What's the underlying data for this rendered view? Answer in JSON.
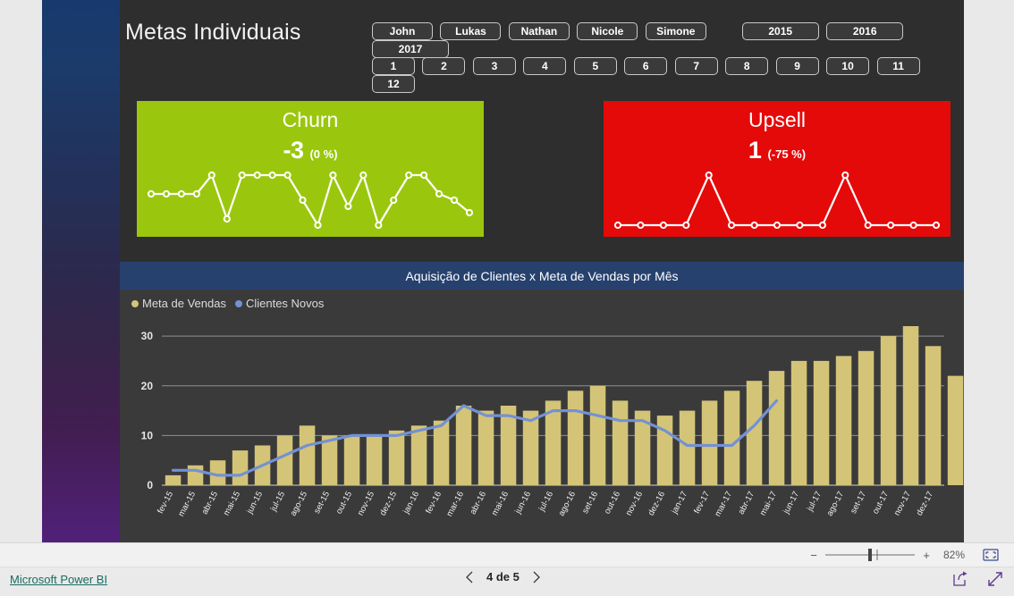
{
  "report": {
    "title": "Metas Individuais"
  },
  "slicers": {
    "people": [
      "John",
      "Lukas",
      "Nathan",
      "Nicole",
      "Simone"
    ],
    "years": [
      "2015",
      "2016",
      "2017"
    ],
    "months": [
      "1",
      "2",
      "3",
      "4",
      "5",
      "6",
      "7",
      "8",
      "9",
      "10",
      "11",
      "12"
    ]
  },
  "kpis": [
    {
      "name": "churn",
      "title": "Churn",
      "value": "-3",
      "delta": "(0 %)",
      "color": "#9ac70d",
      "sparkline": [
        5,
        5,
        5,
        5,
        8,
        1,
        8,
        8,
        8,
        8,
        4,
        0,
        8,
        3,
        8,
        0,
        4,
        8,
        8,
        5,
        4,
        2
      ]
    },
    {
      "name": "upsell",
      "title": "Upsell",
      "value": "1",
      "delta": "(-75 %)",
      "color": "#e40a0a",
      "sparkline": [
        0,
        0,
        0,
        0,
        4,
        0,
        0,
        0,
        0,
        0,
        4,
        0,
        0,
        0,
        0
      ]
    }
  ],
  "chart_data": {
    "type": "bar",
    "title": "Aquisição de Clientes x Meta de Vendas por Mês",
    "xlabel": "",
    "ylabel": "",
    "ylim": [
      0,
      32
    ],
    "yticks": [
      0,
      10,
      20,
      30
    ],
    "grid": true,
    "legend_position": "top-left",
    "legend": [
      "Meta de Vendas",
      "Clientes Novos"
    ],
    "colors": {
      "meta_de_vendas": "#d4c477",
      "clientes_novos": "#7391d4",
      "panel_header": "#27416e",
      "panel_background": "#3a3a3a",
      "canvas_background": "#2e2e2e"
    },
    "categories": [
      "fev-15",
      "mar-15",
      "abr-15",
      "mai-15",
      "jun-15",
      "jul-15",
      "ago-15",
      "set-15",
      "out-15",
      "nov-15",
      "dez-15",
      "jan-16",
      "fev-16",
      "mar-16",
      "abr-16",
      "mai-16",
      "jun-16",
      "jul-16",
      "ago-16",
      "set-16",
      "out-16",
      "nov-16",
      "dez-16",
      "jan-17",
      "fev-17",
      "mar-17",
      "abr-17",
      "mai-17",
      "jun-17",
      "jul-17",
      "ago-17",
      "set-17",
      "out-17",
      "nov-17",
      "dez-17"
    ],
    "series": [
      {
        "name": "Meta de Vendas",
        "type": "bar",
        "color": "#d4c477",
        "values": [
          2,
          4,
          5,
          7,
          8,
          10,
          12,
          10,
          10,
          10,
          11,
          12,
          13,
          16,
          15,
          16,
          15,
          17,
          19,
          20,
          17,
          15,
          14,
          15,
          17,
          19,
          21,
          23,
          25,
          25,
          26,
          27,
          30,
          32,
          28,
          22
        ]
      },
      {
        "name": "Clientes Novos",
        "type": "line",
        "color": "#7391d4",
        "values": [
          3,
          3,
          2,
          2,
          4,
          6,
          8,
          9,
          10,
          10,
          10,
          11,
          12,
          16,
          14,
          14,
          13,
          15,
          15,
          14,
          13,
          13,
          11,
          8,
          8,
          8,
          12,
          17,
          null,
          null,
          null,
          null,
          null,
          null,
          null,
          null
        ]
      }
    ]
  },
  "statusbar": {
    "zoom_minus": "−",
    "zoom_plus": "+",
    "zoom_level": "82%",
    "fit_icon": "fit-to-page-icon",
    "brand": "Microsoft Power BI",
    "prev_icon": "chevron-left-icon",
    "page_indicator": "4 de 5",
    "next_icon": "chevron-right-icon",
    "share_icon": "share-icon",
    "fullscreen_icon": "fullscreen-icon"
  }
}
